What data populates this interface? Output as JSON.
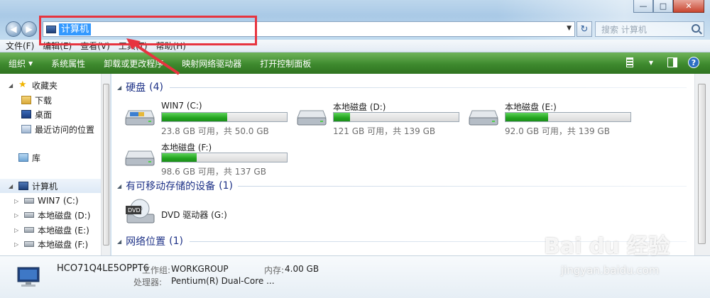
{
  "window": {
    "controls": {
      "minimize": "—",
      "maximize": "□",
      "close": "✕"
    }
  },
  "address_bar": {
    "path": "计算机",
    "search_placeholder": "搜索 计算机"
  },
  "menu": [
    "文件(F)",
    "编辑(E)",
    "查看(V)",
    "工具(T)",
    "帮助(H)"
  ],
  "toolbar": {
    "items": [
      "组织",
      "系统属性",
      "卸载或更改程序",
      "映射网络驱动器",
      "打开控制面板"
    ]
  },
  "nav_pane": {
    "favorites": {
      "label": "收藏夹",
      "items": [
        "下载",
        "桌面",
        "最近访问的位置"
      ]
    },
    "libraries": {
      "label": "库"
    },
    "computer": {
      "label": "计算机",
      "items": [
        "WIN7 (C:)",
        "本地磁盘 (D:)",
        "本地磁盘 (E:)",
        "本地磁盘 (F:)"
      ]
    }
  },
  "content": {
    "hard_disks": {
      "title": "硬盘",
      "count": "(4)"
    },
    "drives": [
      {
        "name": "WIN7 (C:)",
        "free": "23.8 GB 可用，共 50.0 GB",
        "used_fraction": 0.52
      },
      {
        "name": "本地磁盘 (D:)",
        "free": "121 GB 可用，共 139 GB",
        "used_fraction": 0.13
      },
      {
        "name": "本地磁盘 (E:)",
        "free": "92.0 GB 可用，共 139 GB",
        "used_fraction": 0.34
      },
      {
        "name": "本地磁盘 (F:)",
        "free": "98.6 GB 可用，共 137 GB",
        "used_fraction": 0.28
      }
    ],
    "removable": {
      "title": "有可移动存储的设备",
      "count": "(1)",
      "device": "DVD 驱动器 (G:)"
    },
    "network": {
      "title": "网络位置",
      "count": "(1)"
    }
  },
  "details": {
    "computer_name": "HCO71Q4LE5OPPT6",
    "workgroup_label": "工作组:",
    "workgroup": "WORKGROUP",
    "memory_label": "内存:",
    "memory": "4.00 GB",
    "cpu_label": "处理器:",
    "cpu": "Pentium(R) Dual-Core ..."
  },
  "watermark": {
    "brand": "Bai du 经验",
    "url": "jingyan.baidu.com"
  }
}
